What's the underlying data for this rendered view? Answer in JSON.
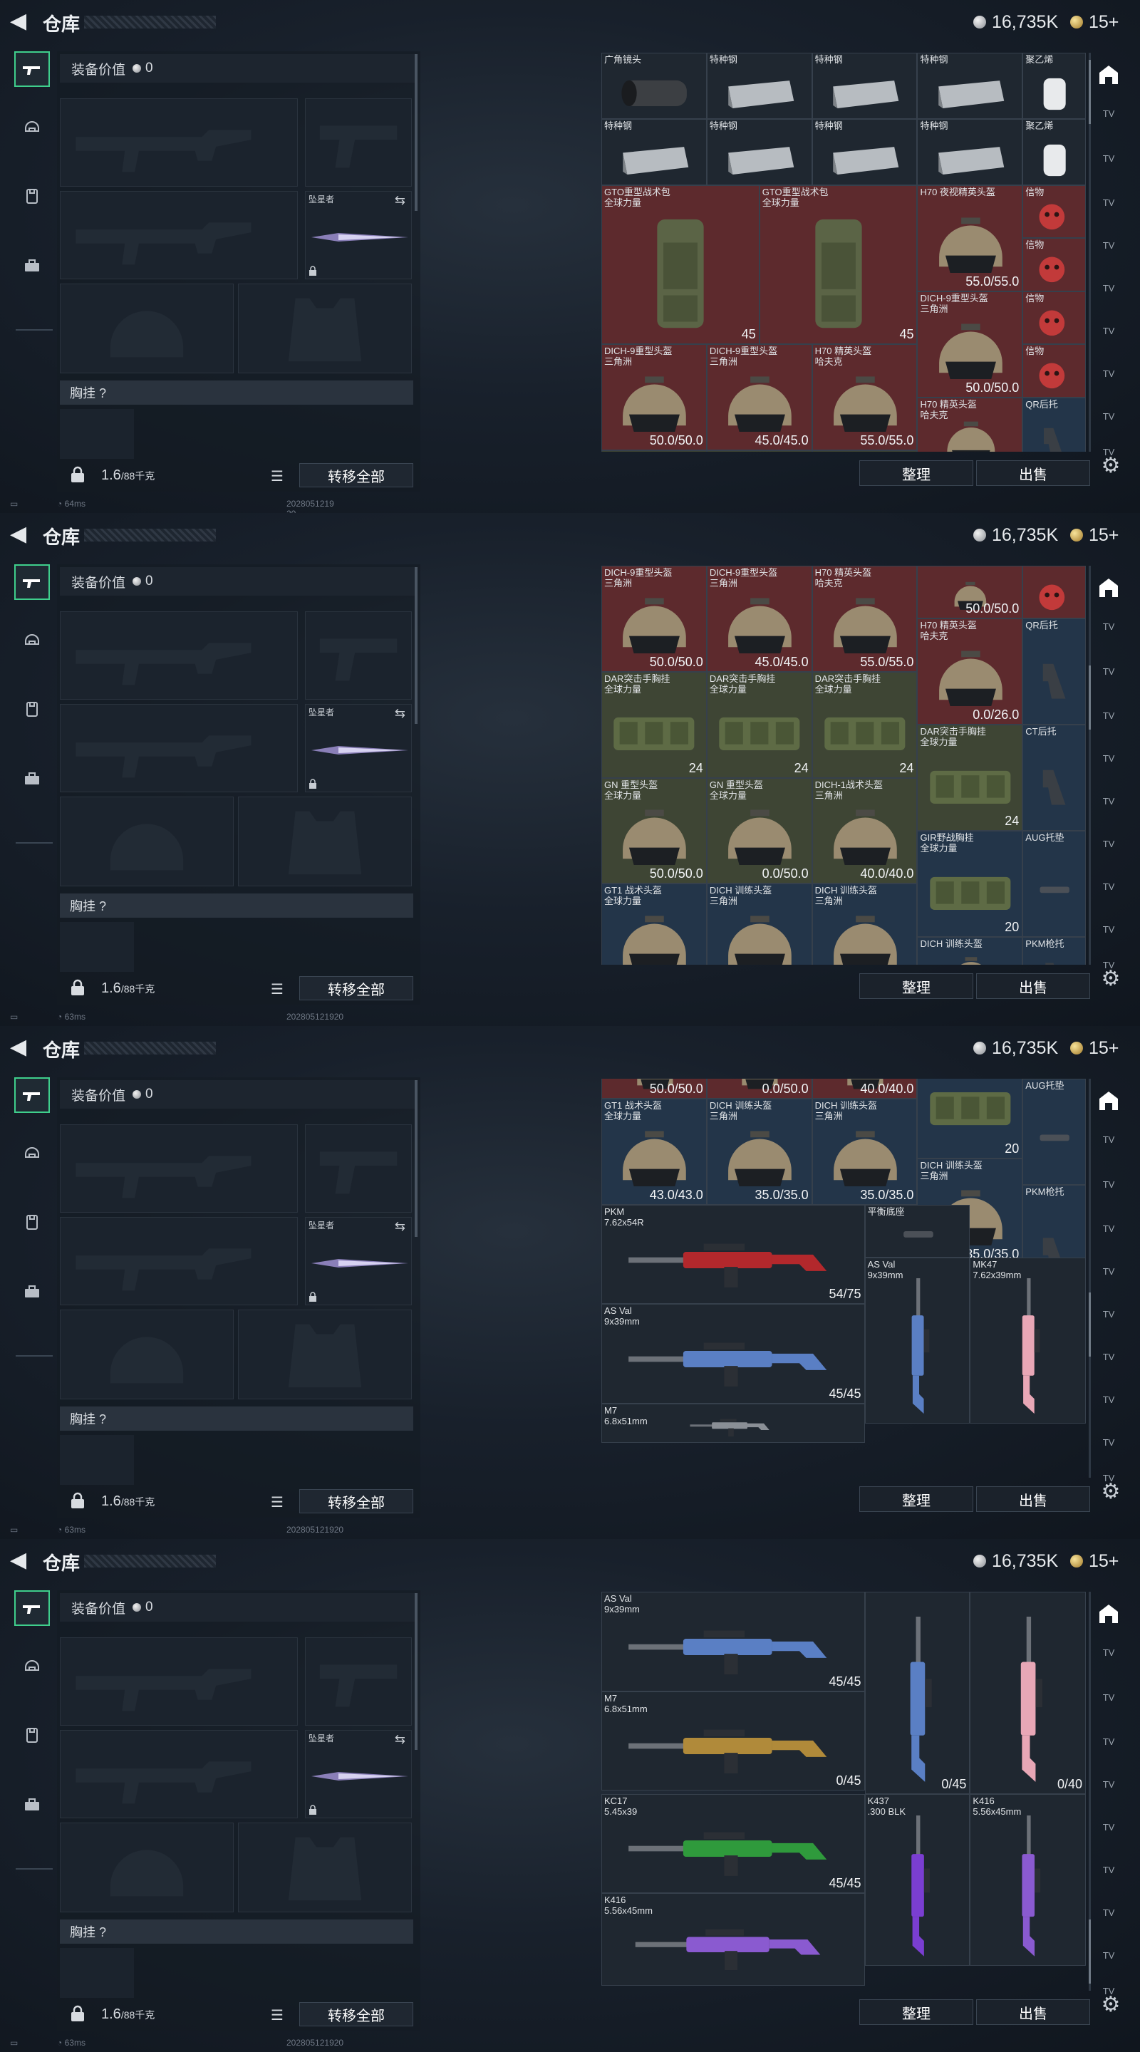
{
  "title": "仓库",
  "currency": {
    "coins": "16,735K",
    "gold": "15+"
  },
  "loadout": {
    "value_label": "装备价值",
    "value": "0",
    "knife_label": "坠星者",
    "chest_label": "胸挂 ?",
    "weight": "1.6",
    "weight_max": "/88千克",
    "transfer_label": "转移全部"
  },
  "actions": {
    "sort": "整理",
    "sell": "出售"
  },
  "right_rail_label": "TV",
  "screens": [
    {
      "ping": "64ms",
      "stamp": "2028051219​20"
    },
    {
      "ping": "63ms",
      "stamp": "202805121920"
    },
    {
      "ping": "63ms",
      "stamp": "202805121920"
    },
    {
      "ping": "63ms",
      "stamp": "202805121920"
    }
  ],
  "items": [
    [
      {
        "name": "广角镜头",
        "kind": "scope",
        "bg": "dark"
      },
      {
        "name": "特种钢",
        "kind": "steel",
        "bg": "dark"
      },
      {
        "name": "特种钢",
        "kind": "steel",
        "bg": "dark"
      },
      {
        "name": "特种钢",
        "kind": "steel",
        "bg": "dark"
      },
      {
        "name": "聚乙烯",
        "kind": "roll",
        "bg": "dark"
      },
      {
        "name": "特种钢",
        "kind": "steel",
        "bg": "dark"
      },
      {
        "name": "特种钢",
        "kind": "steel",
        "bg": "dark"
      },
      {
        "name": "特种钢",
        "kind": "steel",
        "bg": "dark"
      },
      {
        "name": "特种钢",
        "kind": "steel",
        "bg": "dark"
      },
      {
        "name": "聚乙烯",
        "kind": "roll",
        "bg": "dark"
      },
      {
        "name": "GTO重型战术包\n全球力量",
        "kind": "backpack",
        "bg": "red",
        "value": "45"
      },
      {
        "name": "GTO重型战术包\n全球力量",
        "kind": "backpack",
        "bg": "red",
        "value": "45"
      },
      {
        "name": "H70 夜视精英头盔",
        "kind": "helmet",
        "bg": "red",
        "value": "55.0/55.0"
      },
      {
        "name": "信物",
        "kind": "mask",
        "bg": "red"
      },
      {
        "name": "信物",
        "kind": "mask",
        "bg": "red"
      },
      {
        "name": "DICH-9重型头盔\n三角洲",
        "kind": "helmet",
        "bg": "red",
        "value": "50.0/50.0"
      },
      {
        "name": "信物",
        "kind": "mask",
        "bg": "red"
      },
      {
        "name": "DICH-9重型头盔\n三角洲",
        "kind": "helmet",
        "bg": "red",
        "value": "50.0/50.0"
      },
      {
        "name": "DICH-9重型头盔\n三角洲",
        "kind": "helmet",
        "bg": "red",
        "value": "45.0/45.0"
      },
      {
        "name": "H70 精英头盔\n哈夫克",
        "kind": "helmet",
        "bg": "red",
        "value": "55.0/55.0"
      },
      {
        "name": "信物",
        "kind": "mask",
        "bg": "red"
      },
      {
        "name": "H70 精英头盔\n哈夫克",
        "kind": "helmet",
        "bg": "red"
      },
      {
        "name": "QR后托",
        "kind": "stock",
        "bg": "blue"
      },
      {
        "name": "DAR突击手胸挂\n全球力量",
        "kind": "vest",
        "bg": "green"
      },
      {
        "name": "DAR突击手胸挂\n全球力量",
        "kind": "vest",
        "bg": "green"
      },
      {
        "name": "DAR突击手胸挂\n全球力量",
        "kind": "vest",
        "bg": "green"
      }
    ],
    [
      {
        "name": "DICH-9重型头盔\n三角洲",
        "kind": "helmet",
        "bg": "red",
        "value": "50.0/50.0"
      },
      {
        "name": "DICH-9重型头盔\n三角洲",
        "kind": "helmet",
        "bg": "red",
        "value": "45.0/45.0"
      },
      {
        "name": "H70 精英头盔\n哈夫克",
        "kind": "helmet",
        "bg": "red",
        "value": "55.0/55.0"
      },
      {
        "name": "",
        "kind": "helmet",
        "bg": "red",
        "value": "50.0/50.0"
      },
      {
        "name": "",
        "kind": "mask",
        "bg": "red"
      },
      {
        "name": "H70 精英头盔\n哈夫克",
        "kind": "helmet",
        "bg": "red",
        "value": "0.0/26.0"
      },
      {
        "name": "QR后托",
        "kind": "stock",
        "bg": "blue"
      },
      {
        "name": "DAR突击手胸挂\n全球力量",
        "kind": "vest",
        "bg": "green",
        "value": "24"
      },
      {
        "name": "DAR突击手胸挂\n全球力量",
        "kind": "vest",
        "bg": "green",
        "value": "24"
      },
      {
        "name": "DAR突击手胸挂\n全球力量",
        "kind": "vest",
        "bg": "green",
        "value": "24"
      },
      {
        "name": "DAR突击手胸挂\n全球力量",
        "kind": "vest",
        "bg": "green",
        "value": "24"
      },
      {
        "name": "CT后托",
        "kind": "stock",
        "bg": "blue"
      },
      {
        "name": "GN 重型头盔\n全球力量",
        "kind": "helmet",
        "bg": "green",
        "value": "50.0/50.0"
      },
      {
        "name": "GN 重型头盔\n全球力量",
        "kind": "helmet",
        "bg": "green",
        "value": "0.0/50.0"
      },
      {
        "name": "DICH-1战术头盔\n三角洲",
        "kind": "helmet",
        "bg": "green",
        "value": "40.0/40.0"
      },
      {
        "name": "GIR野战胸挂\n全球力量",
        "kind": "vest",
        "bg": "blue",
        "value": "20"
      },
      {
        "name": "AUG托垫",
        "kind": "pad",
        "bg": "blue"
      },
      {
        "name": "GT1 战术头盔\n全球力量",
        "kind": "helmet",
        "bg": "blue"
      },
      {
        "name": "DICH 训练头盔\n三角洲",
        "kind": "helmet",
        "bg": "blue"
      },
      {
        "name": "DICH 训练头盔\n三角洲",
        "kind": "helmet",
        "bg": "blue"
      },
      {
        "name": "DICH 训练头盔",
        "kind": "helmet",
        "bg": "blue"
      },
      {
        "name": "PKM枪托",
        "kind": "stock",
        "bg": "blue"
      }
    ],
    [
      {
        "name": "",
        "kind": "helmet",
        "bg": "red",
        "value": "50.0/50.0"
      },
      {
        "name": "",
        "kind": "helmet",
        "bg": "red",
        "value": "0.0/50.0"
      },
      {
        "name": "",
        "kind": "helmet",
        "bg": "red",
        "value": "40.0/40.0"
      },
      {
        "name": "GIR野战胸挂\n全球力量",
        "kind": "vest",
        "bg": "blue",
        "value": "20"
      },
      {
        "name": "AUG托垫",
        "kind": "pad",
        "bg": "blue"
      },
      {
        "name": "GT1 战术头盔\n全球力量",
        "kind": "helmet",
        "bg": "blue",
        "value": "43.0/43.0"
      },
      {
        "name": "DICH 训练头盔\n三角洲",
        "kind": "helmet",
        "bg": "blue",
        "value": "35.0/35.0"
      },
      {
        "name": "DICH 训练头盔\n三角洲",
        "kind": "helmet",
        "bg": "blue",
        "value": "35.0/35.0"
      },
      {
        "name": "DICH 训练头盔\n三角洲",
        "kind": "helmet",
        "bg": "blue",
        "value": "35.0/35.0"
      },
      {
        "name": "PKM枪托",
        "kind": "stock",
        "bg": "blue"
      },
      {
        "name": "PKM\n7.62x54R",
        "kind": "rifle",
        "bg": "dark",
        "value": "54/75",
        "tint": "#b3282c"
      },
      {
        "name": "平衡底座",
        "kind": "pad",
        "bg": "dark"
      },
      {
        "name": "AS Val\n9x39mm",
        "kind": "vrifle",
        "bg": "dark",
        "tint": "#5a7fc4"
      },
      {
        "name": "MK47\n7.62x39mm",
        "kind": "vrifle",
        "bg": "dark",
        "tint": "#e8a7b6"
      },
      {
        "name": "AS Val\n9x39mm",
        "kind": "rifle",
        "bg": "dark",
        "value": "45/45",
        "tint": "#5a7fc4"
      },
      {
        "name": "M7\n6.8x51mm",
        "kind": "rifle",
        "bg": "dark"
      }
    ],
    [
      {
        "name": "AS Val\n9x39mm",
        "kind": "rifle",
        "bg": "dark",
        "value": "45/45",
        "tint": "#5a7fc4"
      },
      {
        "name": "",
        "kind": "vrifle",
        "bg": "dark",
        "value": "0/45",
        "tint": "#5a7fc4"
      },
      {
        "name": "",
        "kind": "vrifle",
        "bg": "dark",
        "value": "0/40",
        "tint": "#e8a7b6"
      },
      {
        "name": "M7\n6.8x51mm",
        "kind": "rifle",
        "bg": "dark",
        "value": "0/45",
        "tint": "#b08a3a"
      },
      {
        "name": "KC17\n5.45x39",
        "kind": "rifle",
        "bg": "dark",
        "value": "45/45",
        "tint": "#2f9a3c"
      },
      {
        "name": "K437\n.300 BLK",
        "kind": "vrifle",
        "bg": "dark",
        "tint": "#7a3ed1"
      },
      {
        "name": "K416\n5.56x45mm",
        "kind": "vrifle",
        "bg": "dark",
        "tint": "#8a5ad0"
      },
      {
        "name": "K416\n5.56x45mm",
        "kind": "rifle",
        "bg": "dark",
        "tint": "#8a5ad0"
      }
    ]
  ]
}
